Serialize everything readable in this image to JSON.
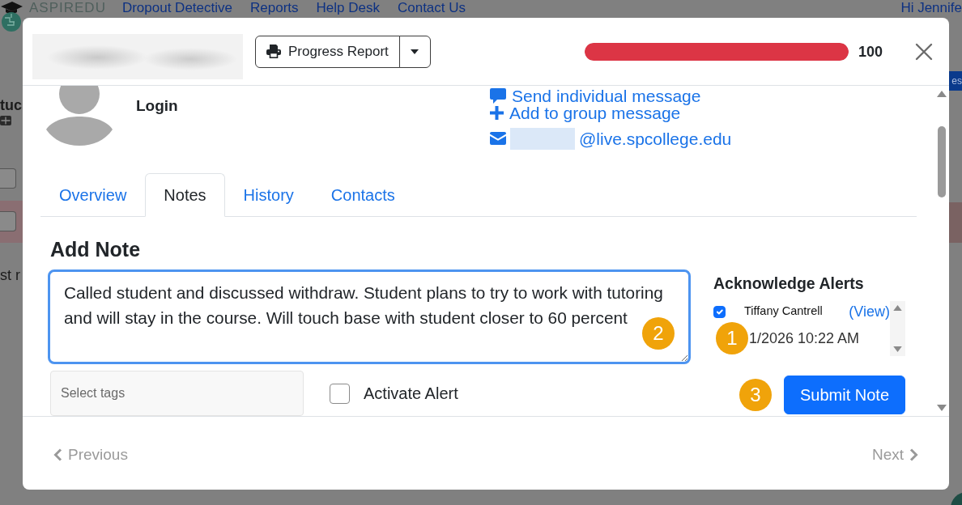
{
  "background_page": {
    "brand": "ASPIREDU",
    "nav_links": [
      "Dropout Detective",
      "Reports",
      "Help Desk",
      "Contact Us"
    ],
    "greeting": "Hi Jennife",
    "heading_fragment": "tuc",
    "text_fragment": "st r",
    "button_fragment": "es"
  },
  "modal": {
    "header": {
      "report_button": "Progress Report",
      "risk_bar": {
        "level": 1,
        "reading": "100"
      }
    },
    "profile": {
      "login_label": "Login",
      "actions": [
        {
          "kind": "message",
          "label": "Send individual message"
        },
        {
          "kind": "group",
          "label": "Add to group message"
        },
        {
          "kind": "email",
          "label": "@live.spcollege.edu"
        }
      ]
    },
    "tabs": [
      {
        "label": "Overview",
        "selected": false
      },
      {
        "label": "Notes",
        "selected": true
      },
      {
        "label": "History",
        "selected": false
      },
      {
        "label": "Contacts",
        "selected": false
      }
    ],
    "add_note": {
      "title": "Add Note",
      "note_text": "Called student and discussed withdraw. Student plans to try to work with tutoring and will stay in the course. Will touch base with student closer to 60 percent",
      "note_callout": "2",
      "tags_placeholder": "Select tags",
      "activate_alert": {
        "label": "Activate Alert",
        "checked": false
      },
      "submit_button": "Submit Note",
      "submit_callout": "3"
    },
    "acknowledge_alerts": {
      "title": "Acknowledge Alerts",
      "alerts": [
        {
          "name": "Tiffany Cantrell",
          "link": "(View)",
          "checked": true,
          "date": "1/2026 10:22 AM",
          "callout": "1"
        }
      ]
    },
    "footer": {
      "previous": {
        "label": "Previous",
        "disabled": true
      },
      "next": {
        "label": "Next",
        "disabled": true
      }
    }
  }
}
